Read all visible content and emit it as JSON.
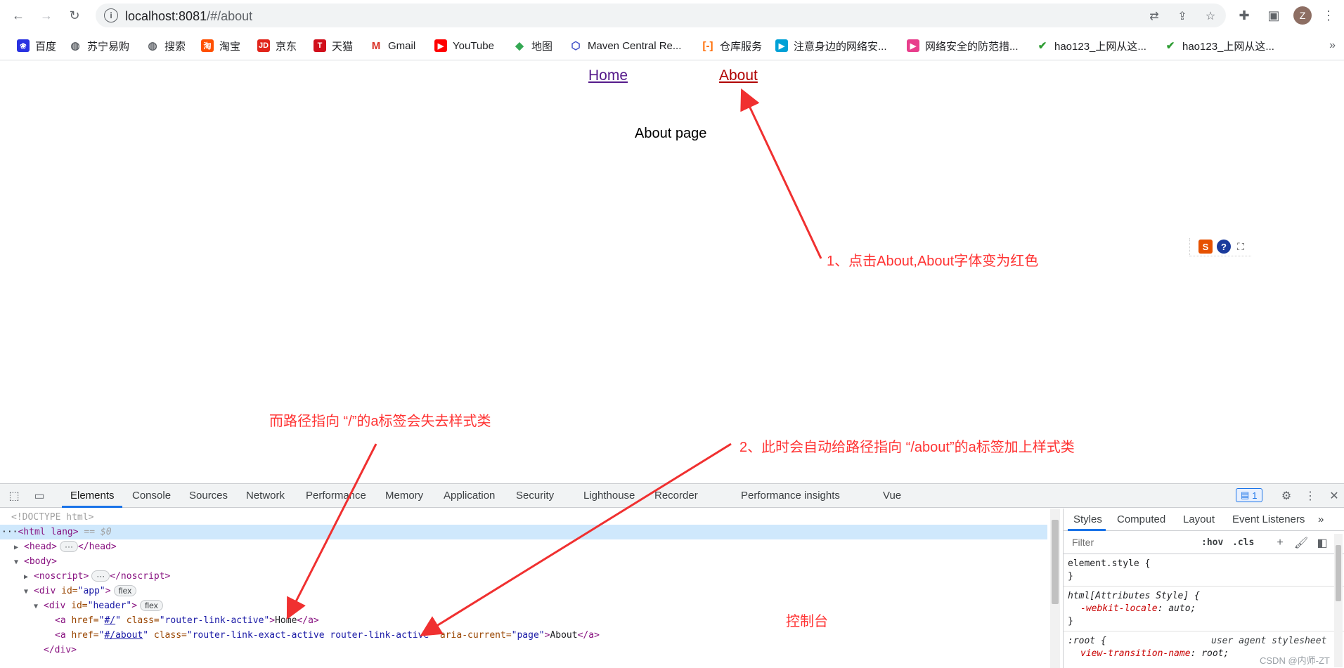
{
  "browser": {
    "url_host": "localhost:8081",
    "url_path": "/#/about",
    "avatar_letter": "Z",
    "bookmarks": [
      {
        "label": "百度",
        "icon": "baidu-paw-icon",
        "color": "#2932e1"
      },
      {
        "label": "苏宁易购",
        "icon": "globe-icon",
        "color": "#5f6368"
      },
      {
        "label": "搜索",
        "icon": "globe-icon",
        "color": "#5f6368"
      },
      {
        "label": "淘宝",
        "icon": "taobao-icon",
        "color": "#ff5000"
      },
      {
        "label": "京东",
        "icon": "jd-icon",
        "color": "#e1251b"
      },
      {
        "label": "天猫",
        "icon": "tmall-icon",
        "color": "#d10f1b"
      },
      {
        "label": "Gmail",
        "icon": "gmail-icon",
        "color": "#d93025"
      },
      {
        "label": "YouTube",
        "icon": "youtube-icon",
        "color": "#ff0000"
      },
      {
        "label": "地图",
        "icon": "maps-icon",
        "color": "#34a853"
      },
      {
        "label": "Maven Central Re...",
        "icon": "maven-hexagon-icon",
        "color": "#4050c8"
      },
      {
        "label": "仓库服务",
        "icon": "aliyun-icon",
        "color": "#ff6a00"
      },
      {
        "label": "注意身边的网络安...",
        "icon": "bilibili-icon",
        "color": "#00a1d6"
      },
      {
        "label": "网络安全的防范措...",
        "icon": "play-icon",
        "color": "#e83e8c"
      },
      {
        "label": "hao123_上网从这...",
        "icon": "hao123-icon",
        "color": "#2e9d33"
      },
      {
        "label": "hao123_上网从这...",
        "icon": "hao123-icon",
        "color": "#2e9d33"
      }
    ],
    "bookmarks_more": "»"
  },
  "page": {
    "nav_home": "Home",
    "nav_about": "About",
    "content": "About page",
    "active_link_color": "#b00000"
  },
  "annotations": {
    "step1": "1、点击About,About字体变为红色",
    "lose_class": "而路径指向 “/”的a标签会失去样式类",
    "step2": "2、此时会自动给路径指向 “/about”的a标签加上样式类",
    "console_label": "控制台",
    "arrow_color": "#f03030"
  },
  "devtools": {
    "tabs": [
      "Elements",
      "Console",
      "Sources",
      "Network",
      "Performance",
      "Memory",
      "Application",
      "Security",
      "Lighthouse",
      "Recorder",
      "Performance insights",
      "Vue"
    ],
    "active_tab": "Elements",
    "issues_count": "1",
    "dom": {
      "doctype": "<!DOCTYPE html>",
      "html_open": "<html lang>",
      "html_eq": "== $0",
      "head": "<head>",
      "head_close": "</head>",
      "body": "<body>",
      "noscript": "<noscript>",
      "noscript_close": "</noscript>",
      "div_app_tag": "<div ",
      "div_app_attr": "id=",
      "div_app_val": "\"app\"",
      "div_app_end": ">",
      "flex_pill": "flex",
      "div_header_tag": "<div ",
      "div_header_attr": "id=",
      "div_header_val": "\"header\"",
      "div_header_end": ">",
      "a_open": "<a ",
      "href_attr": "href=",
      "href_home": "#/",
      "href_about": "#/about",
      "class_attr": " class=",
      "class_home": "\"router-link-active\"",
      "class_about": "\"router-link-exact-active router-link-active\"",
      "aria_attr": " aria-current=",
      "aria_val": "\"page\"",
      "a_close_bracket": ">",
      "home_text": "Home",
      "about_text": "About",
      "a_end": "</a>",
      "div_close": "</div>",
      "ellipsis": "···"
    },
    "styles": {
      "tabs": [
        "Styles",
        "Computed",
        "Layout",
        "Event Listeners"
      ],
      "more": "»",
      "filter_placeholder": "Filter",
      "hov": ":hov",
      "cls": ".cls",
      "rule1_sel": "element.style {",
      "rule1_close": "}",
      "rule2_sel": "html[Attributes Style] {",
      "rule2_prop": "-webkit-locale",
      "rule2_val": ": auto;",
      "rule2_close": "}",
      "rule3_sel": ":root {",
      "rule3_origin": "user agent stylesheet",
      "rule3_prop": "view-transition-name",
      "rule3_val": ": root;"
    },
    "watermark": "CSDN @内师-ZT"
  }
}
